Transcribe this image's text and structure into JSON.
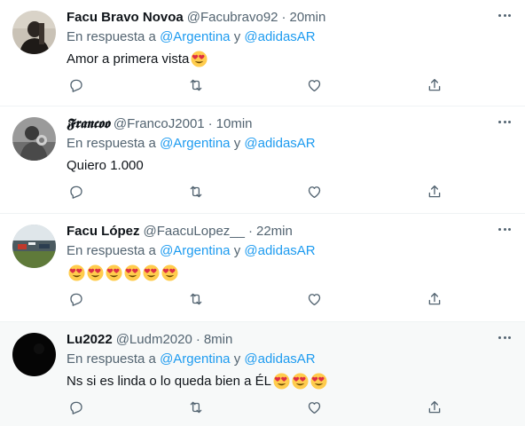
{
  "tweets": [
    {
      "name": "Facu Bravo Novoa",
      "handle": "@Facubravo92",
      "separator": "·",
      "time": "20min",
      "reply_prefix": "En respuesta a",
      "mention1": "@Argentina",
      "reply_join": "y",
      "mention2": "@adidasAR",
      "text": "Amor a primera vista",
      "emoji_count": 1,
      "avatar": "dark-portrait"
    },
    {
      "name": "𝕱𝖗𝖆𝖓𝖈𝖔𝖔",
      "handle": "@FrancoJ2001",
      "separator": "·",
      "time": "10min",
      "reply_prefix": "En respuesta a",
      "mention1": "@Argentina",
      "reply_join": "y",
      "mention2": "@adidasAR",
      "text": "Quiero 1.000",
      "emoji_count": 0,
      "avatar": "grayscale-portrait"
    },
    {
      "name": "Facu López",
      "handle": "@FaacuLopez__",
      "separator": "·",
      "time": "22min",
      "reply_prefix": "En respuesta a",
      "mention1": "@Argentina",
      "reply_join": "y",
      "mention2": "@adidasAR",
      "text": "",
      "emoji_count": 6,
      "avatar": "stadium-photo"
    },
    {
      "name": "Lu2022",
      "handle": "@Ludm2020",
      "separator": "·",
      "time": "8min",
      "reply_prefix": "En respuesta a",
      "mention1": "@Argentina",
      "reply_join": "y",
      "mention2": "@adidasAR",
      "text": "Ns si es linda o lo queda bien a ÉL",
      "emoji_count": 3,
      "avatar": "black-circle"
    }
  ],
  "icons": {
    "more": "more-icon",
    "reply": "reply-icon",
    "retweet": "retweet-icon",
    "like": "heart-icon",
    "share": "share-icon",
    "emoji": "heart-eyes-emoji"
  },
  "colors": {
    "link": "#1d9bf0",
    "secondary_text": "#536471",
    "primary_text": "#0f1419",
    "highlight_bg": "#f7f9f9",
    "divider": "#eff3f4"
  }
}
